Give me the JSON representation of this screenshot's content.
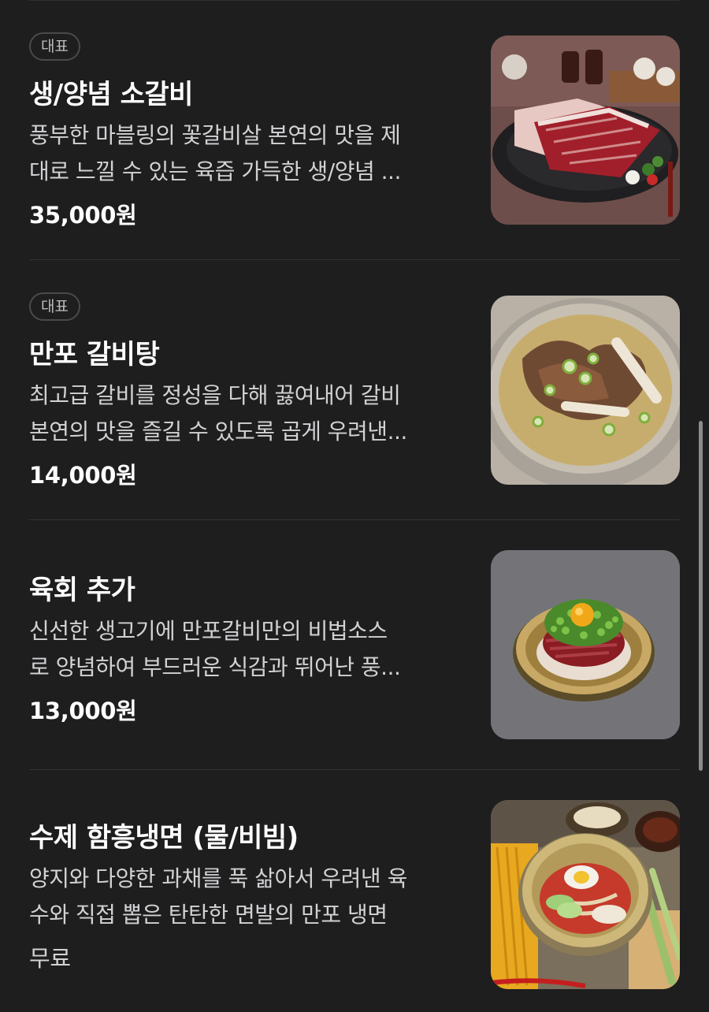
{
  "menu": {
    "items": [
      {
        "badge": "대표",
        "name": "생/양념 소갈비",
        "desc_line1": "풍부한 마블링의 꽃갈비살 본연의 맛을 제",
        "desc_line2": "대로 느낄 수 있는 육즙 가득한 생/양념 ...",
        "price": "35,000원",
        "image_icon": "marbled-beef-rib-photo"
      },
      {
        "badge": "대표",
        "name": "만포 갈비탕",
        "desc_line1": "최고급 갈비를 정성을 다해 끓여내어 갈비",
        "desc_line2": "본연의 맛을 즐길 수 있도록 곱게 우려낸...",
        "price": "14,000원",
        "image_icon": "galbitang-soup-photo"
      },
      {
        "name": "육회 추가",
        "desc_line1": "신선한 생고기에 만포갈비만의 비법소스",
        "desc_line2": "로 양념하여 부드러운 식감과 뛰어난 풍...",
        "price": "13,000원",
        "image_icon": "yukhoe-photo"
      },
      {
        "name": "수제 함흥냉면 (물/비빔)",
        "desc_line1": "양지와 다양한 과채를 푹 삶아서 우려낸 육",
        "desc_line2": "수와 직접 뽑은 탄탄한 면발의 만포 냉면",
        "price": "무료",
        "image_icon": "naengmyeon-photo"
      }
    ]
  },
  "colors": {
    "background": "#1e1e1f",
    "text_primary": "#ffffff",
    "text_secondary": "#d2d2d4",
    "divider": "#343436"
  }
}
